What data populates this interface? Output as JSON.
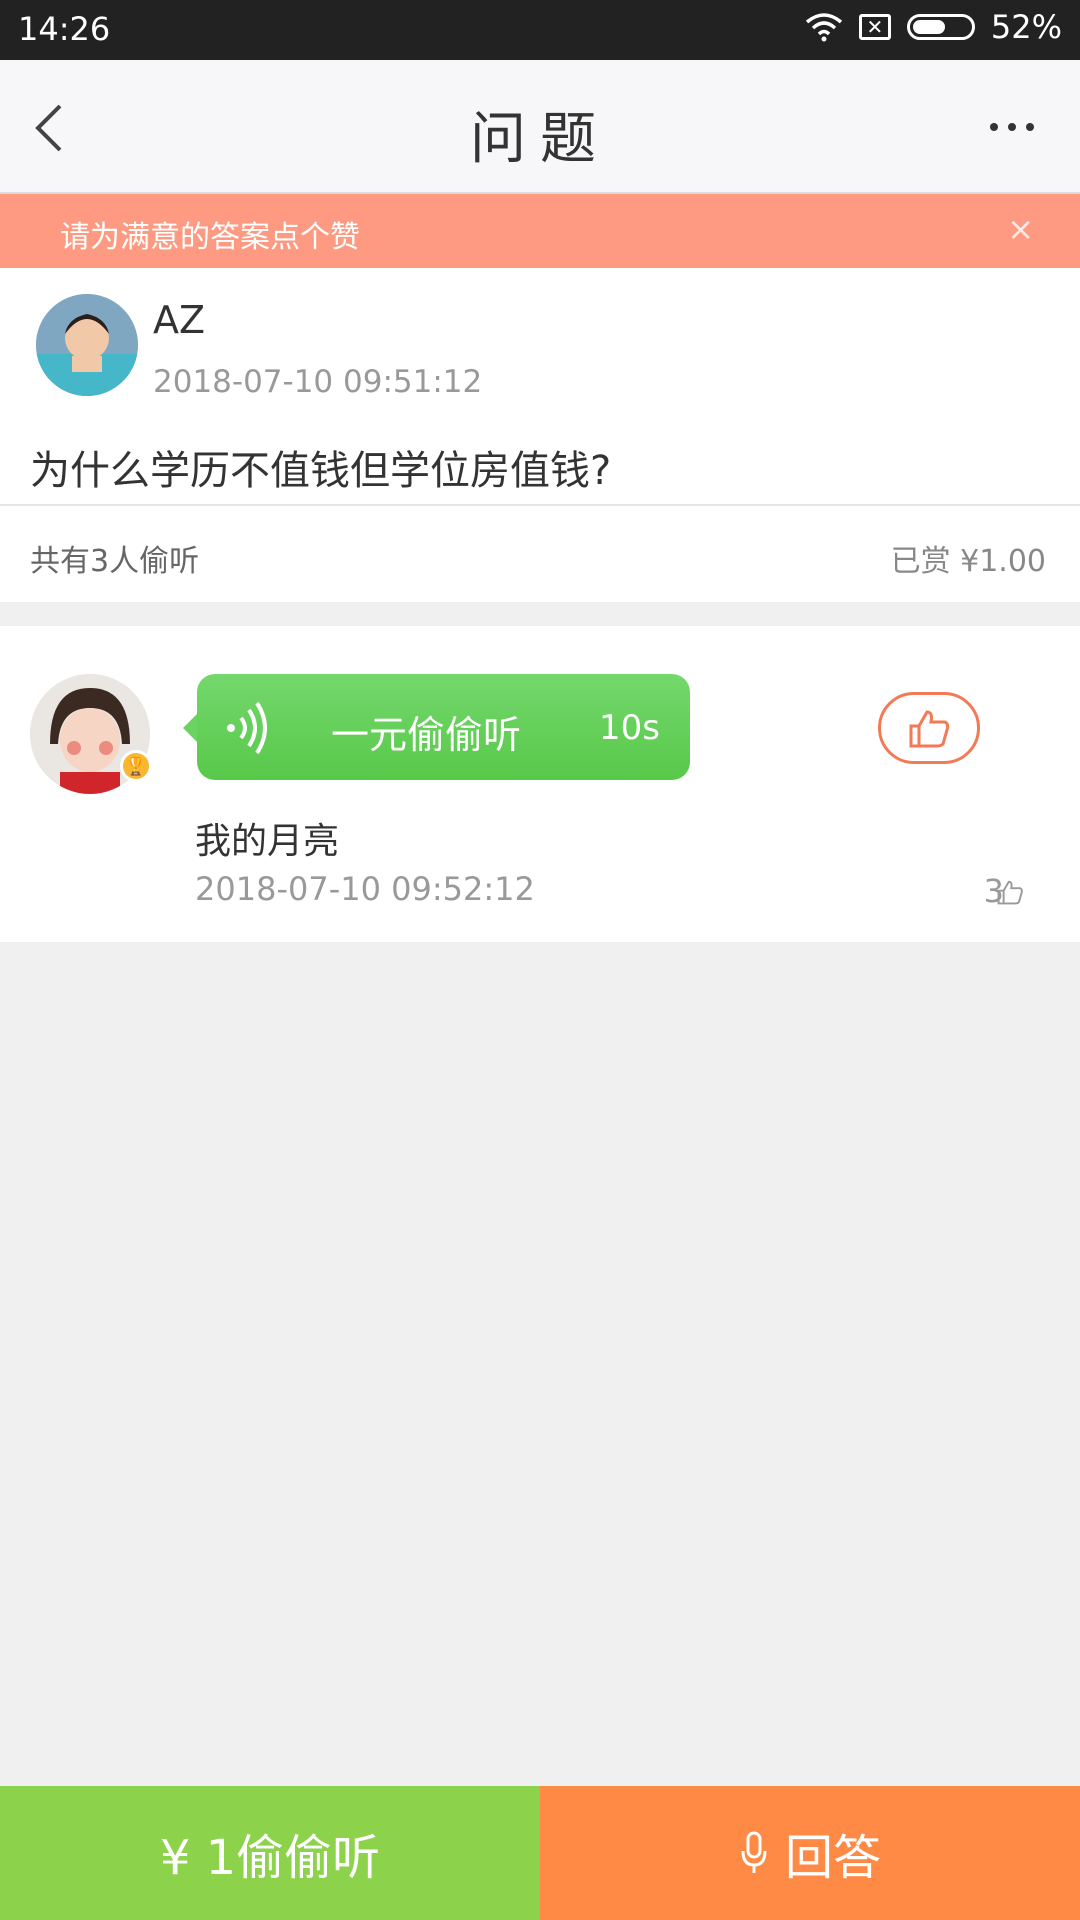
{
  "status": {
    "time": "14:26",
    "battery": "52%"
  },
  "header": {
    "title": "问题"
  },
  "tip": {
    "text": "请为满意的答案点个赞",
    "close": "×"
  },
  "question": {
    "author": "AZ",
    "time": "2018-07-10 09:51:12",
    "text": "为什么学历不值钱但学位房值钱?",
    "listen_count": "共有3人偷听",
    "reward": "已赏 ¥1.00"
  },
  "answer": {
    "bubble_label": "一元偷偷听",
    "duration": "10s",
    "text": "我的月亮",
    "time": "2018-07-10 09:52:12",
    "likes": "3"
  },
  "bottom": {
    "listen_label": "¥ 1偷偷听",
    "answer_label": "回答"
  },
  "colors": {
    "accent_orange": "#fe8a46",
    "accent_green": "#8cd24b",
    "tip_bg": "#fe9a81"
  }
}
